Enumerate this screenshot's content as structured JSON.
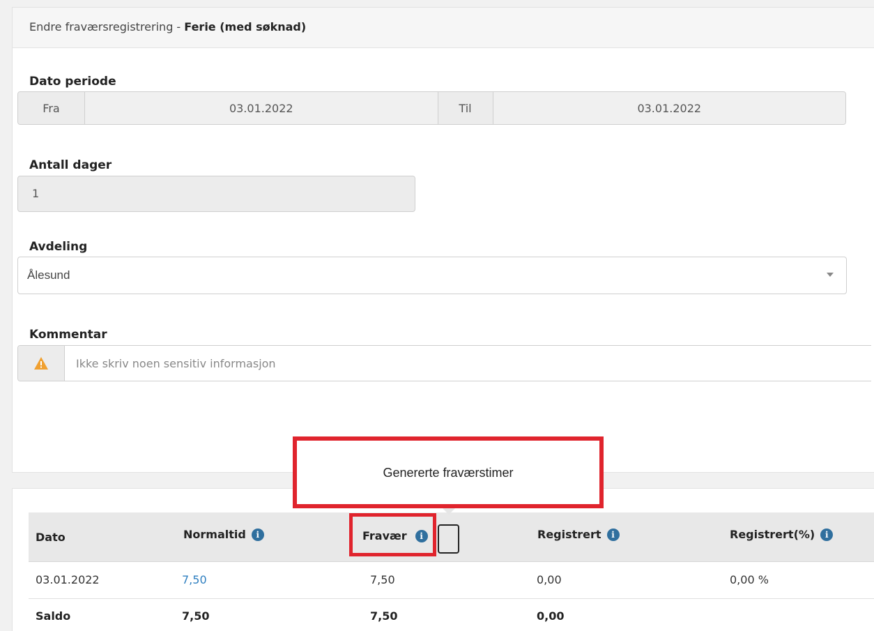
{
  "header": {
    "title_prefix": "Endre fraværsregistrering - ",
    "title_type": "Ferie (med søknad)"
  },
  "date_period": {
    "label": "Dato periode",
    "from_label": "Fra",
    "from_value": "03.01.2022",
    "to_label": "Til",
    "to_value": "03.01.2022"
  },
  "days": {
    "label": "Antall dager",
    "value": "1"
  },
  "department": {
    "label": "Avdeling",
    "selected": "Ålesund"
  },
  "comment": {
    "label": "Kommentar",
    "placeholder": "Ikke skriv noen sensitiv informasjon",
    "icon": "warning-icon",
    "icon_color": "#f0a030"
  },
  "tooltip": {
    "text": "Genererte fraværstimer"
  },
  "table": {
    "columns": [
      "Dato",
      "Normaltid",
      "Fravær",
      "Registrert",
      "Registrert(%)"
    ],
    "rows": [
      {
        "dato": "03.01.2022",
        "normaltid": "7,50",
        "fravaer": "7,50",
        "registrert": "0,00",
        "registrert_pct": "0,00 %"
      }
    ],
    "total": {
      "label": "Saldo",
      "normaltid": "7,50",
      "fravaer": "7,50",
      "registrert": "0,00"
    }
  },
  "colors": {
    "highlight": "#e0242d",
    "info_icon": "#2f6f9e",
    "link": "#2f7fc0"
  }
}
